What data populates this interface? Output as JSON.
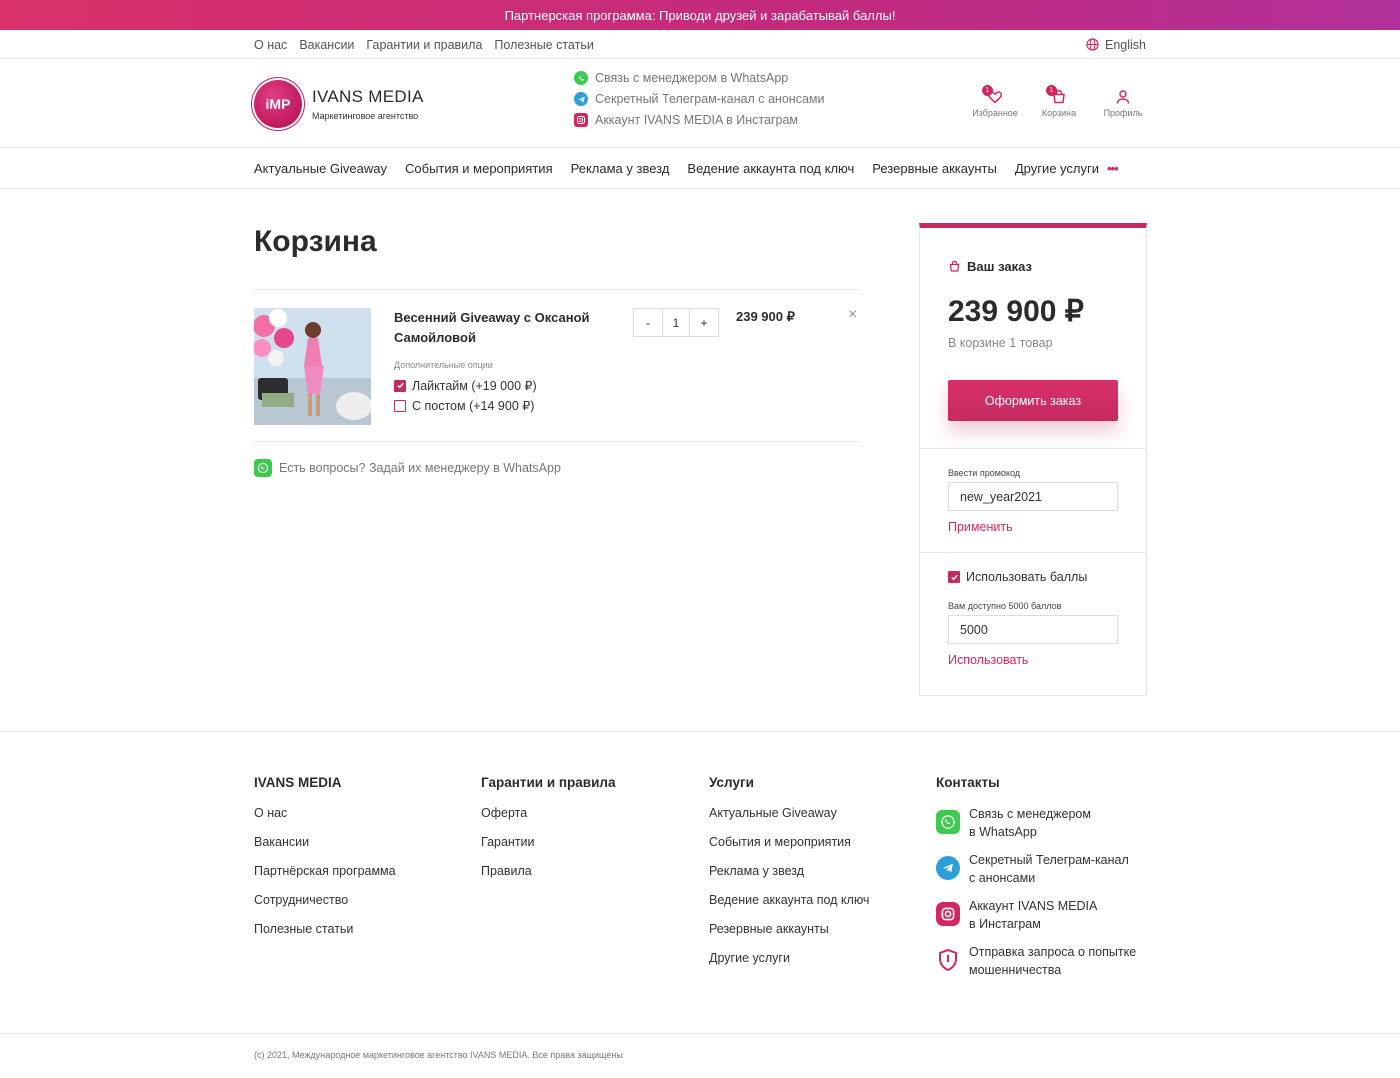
{
  "promo": {
    "text": "Партнерская программа: Приводи друзей и зарабатывай баллы!"
  },
  "topnav": {
    "links": [
      "О нас",
      "Вакансии",
      "Гарантии и правила",
      "Полезные статьи"
    ],
    "language": "English"
  },
  "header": {
    "logo_text": "iMP",
    "brand_name": "IVANS MEDIA",
    "brand_sub": "Маркетинговое агентство",
    "contacts": [
      {
        "icon": "whatsapp-icon",
        "text": "Связь с менеджером в WhatsApp"
      },
      {
        "icon": "telegram-icon",
        "text": "Секретный Телеграм-канал с анонсами"
      },
      {
        "icon": "instagram-icon",
        "text": "Аккаунт IVANS MEDIA в Инстаграм"
      }
    ],
    "actions": {
      "favorites": {
        "label": "Избранное",
        "count": "1"
      },
      "cart": {
        "label": "Корзина",
        "count": "1"
      },
      "profile": {
        "label": "Профиль"
      }
    }
  },
  "catnav": {
    "items": [
      "Актуальные Giveaway",
      "События и мероприятия",
      "Реклама у звезд",
      "Ведение аккаунта под ключ",
      "Резервные аккаунты",
      "Другие услуги"
    ],
    "more": "•••"
  },
  "cart": {
    "title": "Корзина",
    "item": {
      "title": "Весенний Giveaway с Оксаной Самойловой",
      "options_label": "Дополнительные опции",
      "options": [
        {
          "label": "Лайктайм (+19 000 ₽)",
          "checked": true
        },
        {
          "label": "С постом (+14 900 ₽)",
          "checked": false
        }
      ],
      "qty_minus": "-",
      "qty": "1",
      "qty_plus": "+",
      "price": "239 900 ₽",
      "remove": "×"
    },
    "whatsapp_question": "Есть вопросы? Задай их менеджеру в WhatsApp"
  },
  "order": {
    "heading": "Ваш заказ",
    "total": "239 900 ₽",
    "count_text": "В корзине 1 товар",
    "checkout_label": "Оформить заказ",
    "promo_label": "Ввести промокод",
    "promo_value": "new_year2021",
    "promo_apply": "Применить",
    "points_checkbox": "Использовать баллы",
    "points_available": "Вам доступно 5000 баллов",
    "points_value": "5000",
    "points_apply": "Использовать"
  },
  "footer": {
    "col1": {
      "title": "IVANS MEDIA",
      "links": [
        "О нас",
        "Вакансии",
        "Партнёрская программа",
        "Сотрудничество",
        "Полезные статьи"
      ]
    },
    "col2": {
      "title": "Гарантии и правила",
      "links": [
        "Оферта",
        "Гарантии",
        "Правила"
      ]
    },
    "col3": {
      "title": "Услуги",
      "links": [
        "Актуальные Giveaway",
        "События и мероприятия",
        "Реклама у звезд",
        "Ведение аккаунта под ключ",
        "Резервные аккаунты",
        "Другие услуги"
      ]
    },
    "col4": {
      "title": "Контакты",
      "items": [
        {
          "icon": "whatsapp-icon",
          "line1": "Связь с менеджером",
          "line2": "в WhatsApp"
        },
        {
          "icon": "telegram-icon",
          "line1": "Секретный Телеграм-канал",
          "line2": "с анонсами"
        },
        {
          "icon": "instagram-icon",
          "line1": "Аккаунт IVANS MEDIA",
          "line2": "в Инстаграм"
        },
        {
          "icon": "shield-icon",
          "line1": "Отправка запроса о попытке",
          "line2": "мошенничества"
        }
      ]
    },
    "copyright": "(c) 2021, Международное маркетинговое агентство IVANS MEDIA. Все права защищены"
  },
  "colors": {
    "accent": "#c42a5f",
    "whatsapp": "#3ec94f",
    "telegram": "#2e9fd8"
  }
}
